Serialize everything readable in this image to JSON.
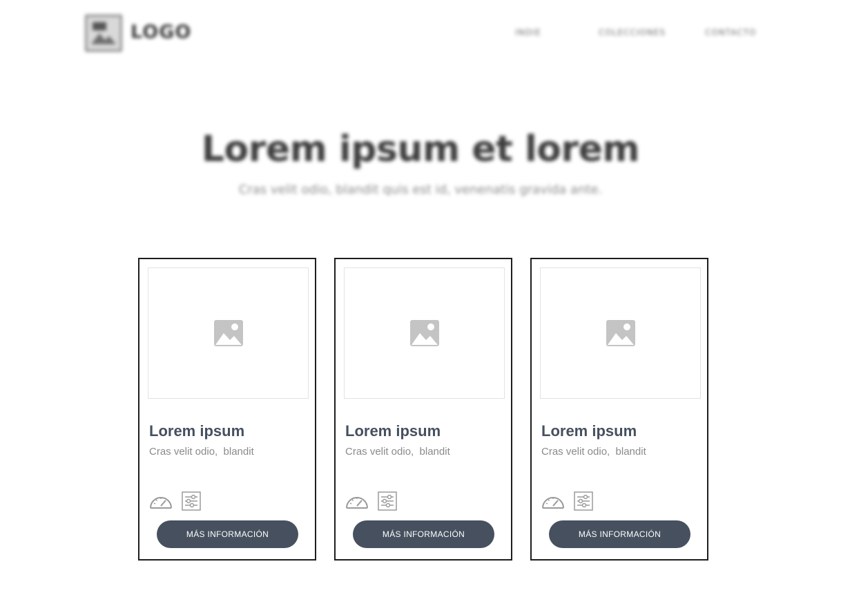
{
  "header": {
    "logo_text": "LOGO",
    "nav": [
      {
        "label": "INDIE"
      },
      {
        "label": "COLECCIONES"
      },
      {
        "label": "CONTACTO"
      }
    ]
  },
  "hero": {
    "title": "Lorem ipsum et lorem",
    "subtitle": "Cras velit odio, blandit quis est id, venenatis gravida ante."
  },
  "cards": [
    {
      "title": "Lorem ipsum",
      "subtitle": "Cras velit odio,  blandit",
      "button": "MÁS INFORMACIÓN",
      "icons": [
        "gauge-icon",
        "sliders-icon"
      ]
    },
    {
      "title": "Lorem ipsum",
      "subtitle": "Cras velit odio,  blandit",
      "button": "MÁS INFORMACIÓN",
      "icons": [
        "gauge-icon",
        "sliders-icon"
      ]
    },
    {
      "title": "Lorem ipsum",
      "subtitle": "Cras velit odio,  blandit",
      "button": "MÁS INFORMACIÓN",
      "icons": [
        "gauge-icon",
        "sliders-icon"
      ]
    }
  ],
  "colors": {
    "button_bg": "#46505f",
    "title_text": "#46505f",
    "card_border": "#1d1d1d",
    "placeholder_icon": "#bdbdbd"
  }
}
